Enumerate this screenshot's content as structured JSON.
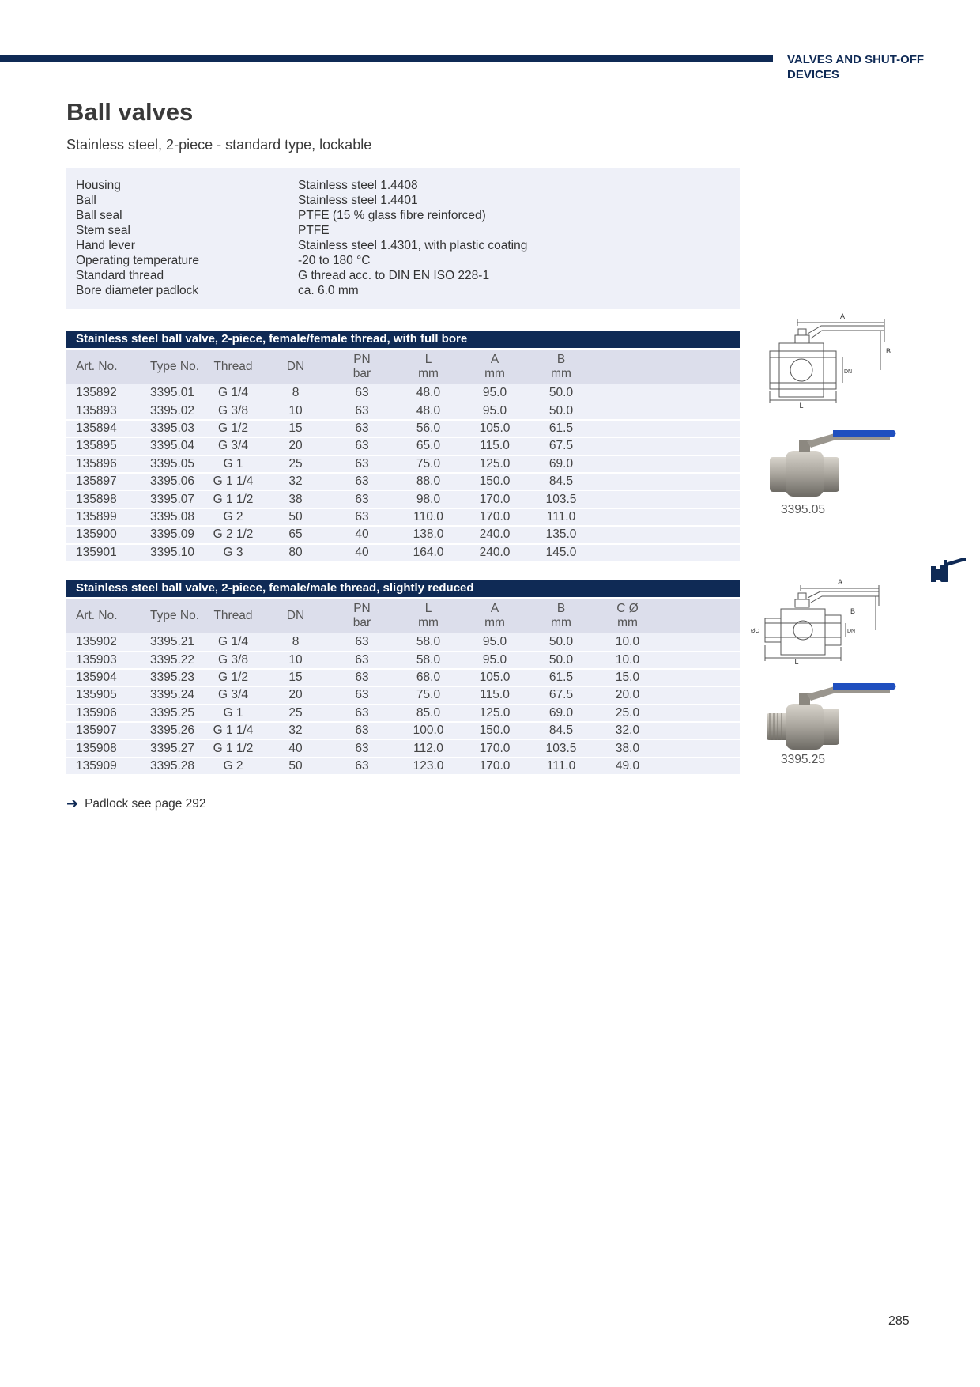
{
  "header": {
    "section": "VALVES AND SHUT-OFF DEVICES"
  },
  "title": "Ball valves",
  "subtitle": "Stainless steel, 2-piece - standard type, lockable",
  "specs": [
    {
      "label": "Housing",
      "value": "Stainless steel 1.4408"
    },
    {
      "label": "Ball",
      "value": "Stainless steel 1.4401"
    },
    {
      "label": "Ball seal",
      "value": "PTFE (15 % glass fibre reinforced)"
    },
    {
      "label": "Stem seal",
      "value": "PTFE"
    },
    {
      "label": "Hand lever",
      "value": "Stainless steel 1.4301, with plastic coating"
    },
    {
      "label": "Operating temperature",
      "value": "-20 to 180 °C"
    },
    {
      "label": "Standard thread",
      "value": "G thread acc. to DIN EN ISO 228-1"
    },
    {
      "label": "Bore diameter padlock",
      "value": "ca. 6.0 mm"
    }
  ],
  "tables": [
    {
      "title": "Stainless steel ball valve, 2-piece, female/female thread, with full bore",
      "headers": [
        {
          "l1": "Art. No.",
          "l2": ""
        },
        {
          "l1": "Type No.",
          "l2": ""
        },
        {
          "l1": "Thread",
          "l2": ""
        },
        {
          "l1": "DN",
          "l2": ""
        },
        {
          "l1": "PN",
          "l2": "bar"
        },
        {
          "l1": "L",
          "l2": "mm"
        },
        {
          "l1": "A",
          "l2": "mm"
        },
        {
          "l1": "B",
          "l2": "mm"
        }
      ],
      "rows": [
        [
          "135892",
          "3395.01",
          "G 1/4",
          "8",
          "63",
          "48.0",
          "95.0",
          "50.0"
        ],
        [
          "135893",
          "3395.02",
          "G 3/8",
          "10",
          "63",
          "48.0",
          "95.0",
          "50.0"
        ],
        [
          "135894",
          "3395.03",
          "G 1/2",
          "15",
          "63",
          "56.0",
          "105.0",
          "61.5"
        ],
        [
          "135895",
          "3395.04",
          "G 3/4",
          "20",
          "63",
          "65.0",
          "115.0",
          "67.5"
        ],
        [
          "135896",
          "3395.05",
          "G 1",
          "25",
          "63",
          "75.0",
          "125.0",
          "69.0"
        ],
        [
          "135897",
          "3395.06",
          "G 1 1/4",
          "32",
          "63",
          "88.0",
          "150.0",
          "84.5"
        ],
        [
          "135898",
          "3395.07",
          "G 1 1/2",
          "38",
          "63",
          "98.0",
          "170.0",
          "103.5"
        ],
        [
          "135899",
          "3395.08",
          "G 2",
          "50",
          "63",
          "110.0",
          "170.0",
          "111.0"
        ],
        [
          "135900",
          "3395.09",
          "G 2 1/2",
          "65",
          "40",
          "138.0",
          "240.0",
          "135.0"
        ],
        [
          "135901",
          "3395.10",
          "G 3",
          "80",
          "40",
          "164.0",
          "240.0",
          "145.0"
        ]
      ],
      "diagram_labels": {
        "a": "A",
        "b": "B",
        "l": "L",
        "dn": "DN"
      },
      "image_caption": "3395.05"
    },
    {
      "title": "Stainless steel ball valve, 2-piece, female/male thread, slightly reduced",
      "headers": [
        {
          "l1": "Art. No.",
          "l2": ""
        },
        {
          "l1": "Type No.",
          "l2": ""
        },
        {
          "l1": "Thread",
          "l2": ""
        },
        {
          "l1": "DN",
          "l2": ""
        },
        {
          "l1": "PN",
          "l2": "bar"
        },
        {
          "l1": "L",
          "l2": "mm"
        },
        {
          "l1": "A",
          "l2": "mm"
        },
        {
          "l1": "B",
          "l2": "mm"
        },
        {
          "l1": "C Ø",
          "l2": "mm"
        }
      ],
      "rows": [
        [
          "135902",
          "3395.21",
          "G 1/4",
          "8",
          "63",
          "58.0",
          "95.0",
          "50.0",
          "10.0"
        ],
        [
          "135903",
          "3395.22",
          "G 3/8",
          "10",
          "63",
          "58.0",
          "95.0",
          "50.0",
          "10.0"
        ],
        [
          "135904",
          "3395.23",
          "G 1/2",
          "15",
          "63",
          "68.0",
          "105.0",
          "61.5",
          "15.0"
        ],
        [
          "135905",
          "3395.24",
          "G 3/4",
          "20",
          "63",
          "75.0",
          "115.0",
          "67.5",
          "20.0"
        ],
        [
          "135906",
          "3395.25",
          "G 1",
          "25",
          "63",
          "85.0",
          "125.0",
          "69.0",
          "25.0"
        ],
        [
          "135907",
          "3395.26",
          "G 1 1/4",
          "32",
          "63",
          "100.0",
          "150.0",
          "84.5",
          "32.0"
        ],
        [
          "135908",
          "3395.27",
          "G 1 1/2",
          "40",
          "63",
          "112.0",
          "170.0",
          "103.5",
          "38.0"
        ],
        [
          "135909",
          "3395.28",
          "G 2",
          "50",
          "63",
          "123.0",
          "170.0",
          "111.0",
          "49.0"
        ]
      ],
      "diagram_labels": {
        "a": "A",
        "b": "B",
        "l": "L",
        "dn": "DN",
        "c": "ØC"
      },
      "image_caption": "3395.25"
    }
  ],
  "footnote": {
    "icon": "arrow-right-icon",
    "text": "Padlock see page 292"
  },
  "page_number": "285",
  "colors": {
    "navy": "#0f2a55",
    "light_bg": "#eef0f8",
    "header_bg": "#dcdeeb",
    "lever_blue": "#1f4fbf"
  }
}
